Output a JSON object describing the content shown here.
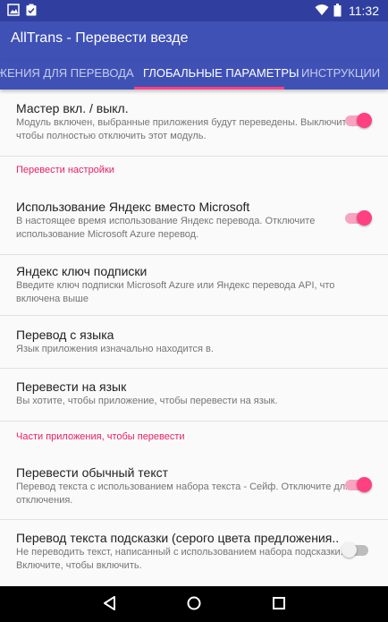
{
  "status_bar": {
    "time": "11:32",
    "icons": [
      "image-icon",
      "clipboard-check-icon",
      "wifi-icon",
      "battery-icon"
    ]
  },
  "app_bar": {
    "title": "AllTrans - Перевести везде"
  },
  "tabs": [
    {
      "label": "ЖЕНИЯ ДЛЯ ПЕРЕВОДА",
      "active": false
    },
    {
      "label": "ГЛОБАЛЬНЫЕ ПАРАМЕТРЫ",
      "active": true
    },
    {
      "label": "ИНСТРУКЦИИ",
      "active": false
    }
  ],
  "accent_color": "#ff4081",
  "primary_color": "#3f51b5",
  "prefs": {
    "master": {
      "title": "Мастер вкл. / выкл.",
      "summary": "Модуль включен, выбранные приложения будут переведены. Выключите, чтобы полностью отключить этот модуль.",
      "enabled": true
    },
    "translate_settings_header": "Перевести настройки",
    "yandex_instead": {
      "title": "Использование Яндекс вместо Microsoft",
      "summary": "В настоящее время использование Яндекс перевода. Отключите использование Microsoft Azure перевод.",
      "enabled": true
    },
    "subscription_key": {
      "title": "Яндекс ключ подписки",
      "summary": "Введите ключ подписки Microsoft Azure или Яндекс перевода API, что включена выше"
    },
    "from_lang": {
      "title": "Перевод с языка",
      "summary": "Язык приложения изначально находится в."
    },
    "to_lang": {
      "title": "Перевести на язык",
      "summary": "Вы хотите, чтобы приложение, чтобы перевести на язык."
    },
    "app_parts_header": "Части приложения, чтобы перевести",
    "normal_text": {
      "title": "Перевести обычный текст",
      "summary": "Перевод текста с использованием набора текста - Сейф. Отключите для отключения.",
      "enabled": true
    },
    "hint_text": {
      "title": "Перевод текста подсказки (серого цвета предложения..",
      "summary": "Не переводить текст, написанный с использованием набора подсказки. Включите, чтобы включить.",
      "enabled": false
    }
  },
  "nav_bar": {
    "buttons": [
      "back-icon",
      "home-icon",
      "recents-icon"
    ]
  }
}
